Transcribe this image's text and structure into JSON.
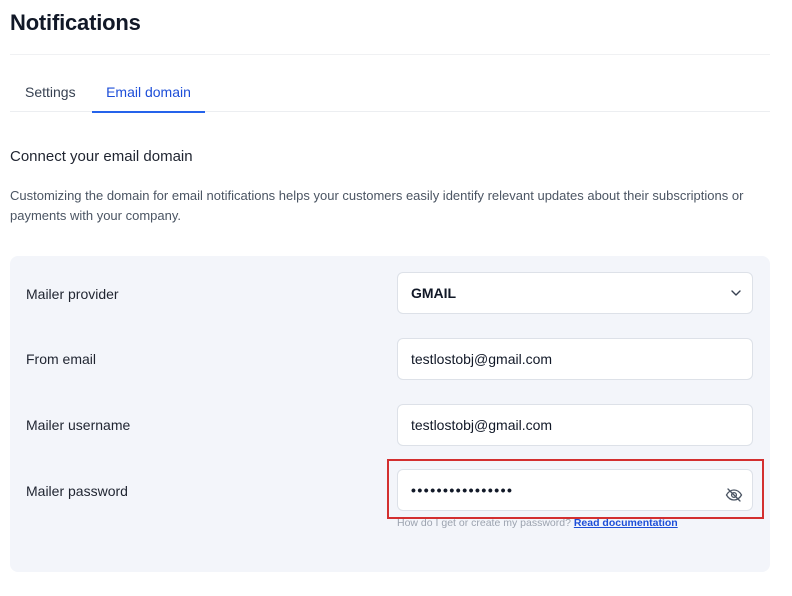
{
  "header": {
    "title": "Notifications"
  },
  "tabs": [
    {
      "label": "Settings",
      "active": false
    },
    {
      "label": "Email domain",
      "active": true
    }
  ],
  "section": {
    "heading": "Connect your email domain",
    "description": "Customizing the domain for email notifications helps your customers easily identify relevant updates about their subscriptions or payments with your company."
  },
  "form": {
    "provider": {
      "label": "Mailer provider",
      "value": "GMAIL"
    },
    "from_email": {
      "label": "From email",
      "value": "testlostobj@gmail.com"
    },
    "username": {
      "label": "Mailer username",
      "value": "testlostobj@gmail.com"
    },
    "password": {
      "label": "Mailer password",
      "value": "••••••••••••••••",
      "help_text": "How do I get or create my password?",
      "help_link": "Read documentation"
    }
  },
  "icons": {
    "select_chevron": "chevron-down-icon",
    "password_toggle": "eye-off-icon"
  },
  "colors": {
    "accent": "#2563eb",
    "panel_bg": "#f3f5fa",
    "highlight": "#d32f2f"
  }
}
